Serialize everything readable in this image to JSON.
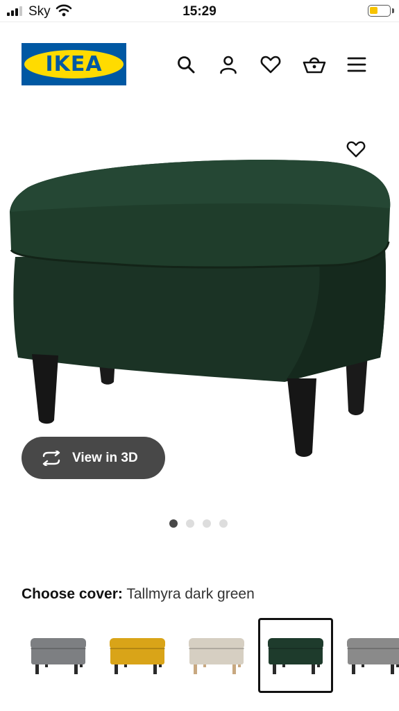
{
  "status_bar": {
    "carrier": "Sky",
    "time": "15:29",
    "battery_level": 0.4,
    "battery_color": "#f7c300"
  },
  "header": {
    "logo_text": "IKEA",
    "brand_blue": "#0058a3",
    "brand_yellow": "#ffdb00",
    "icons": [
      "search-icon",
      "profile-icon",
      "heart-icon",
      "basket-icon",
      "menu-icon"
    ]
  },
  "product": {
    "view_3d_label": "View in 3D",
    "image_count": 4,
    "active_image": 1,
    "cover_label": "Choose cover:",
    "cover_value": "Tallmyra dark green",
    "swatches": [
      {
        "color": "#7d7f82",
        "legs": "#2a2a2a"
      },
      {
        "color": "#d9a418",
        "legs": "#2a2a2a"
      },
      {
        "color": "#d6cfc2",
        "legs": "#c8a880"
      },
      {
        "color": "#1e3b2c",
        "legs": "#2a2a2a"
      },
      {
        "color": "#8a8a8a",
        "legs": "#2a2a2a"
      }
    ],
    "selected_swatch": 4
  }
}
